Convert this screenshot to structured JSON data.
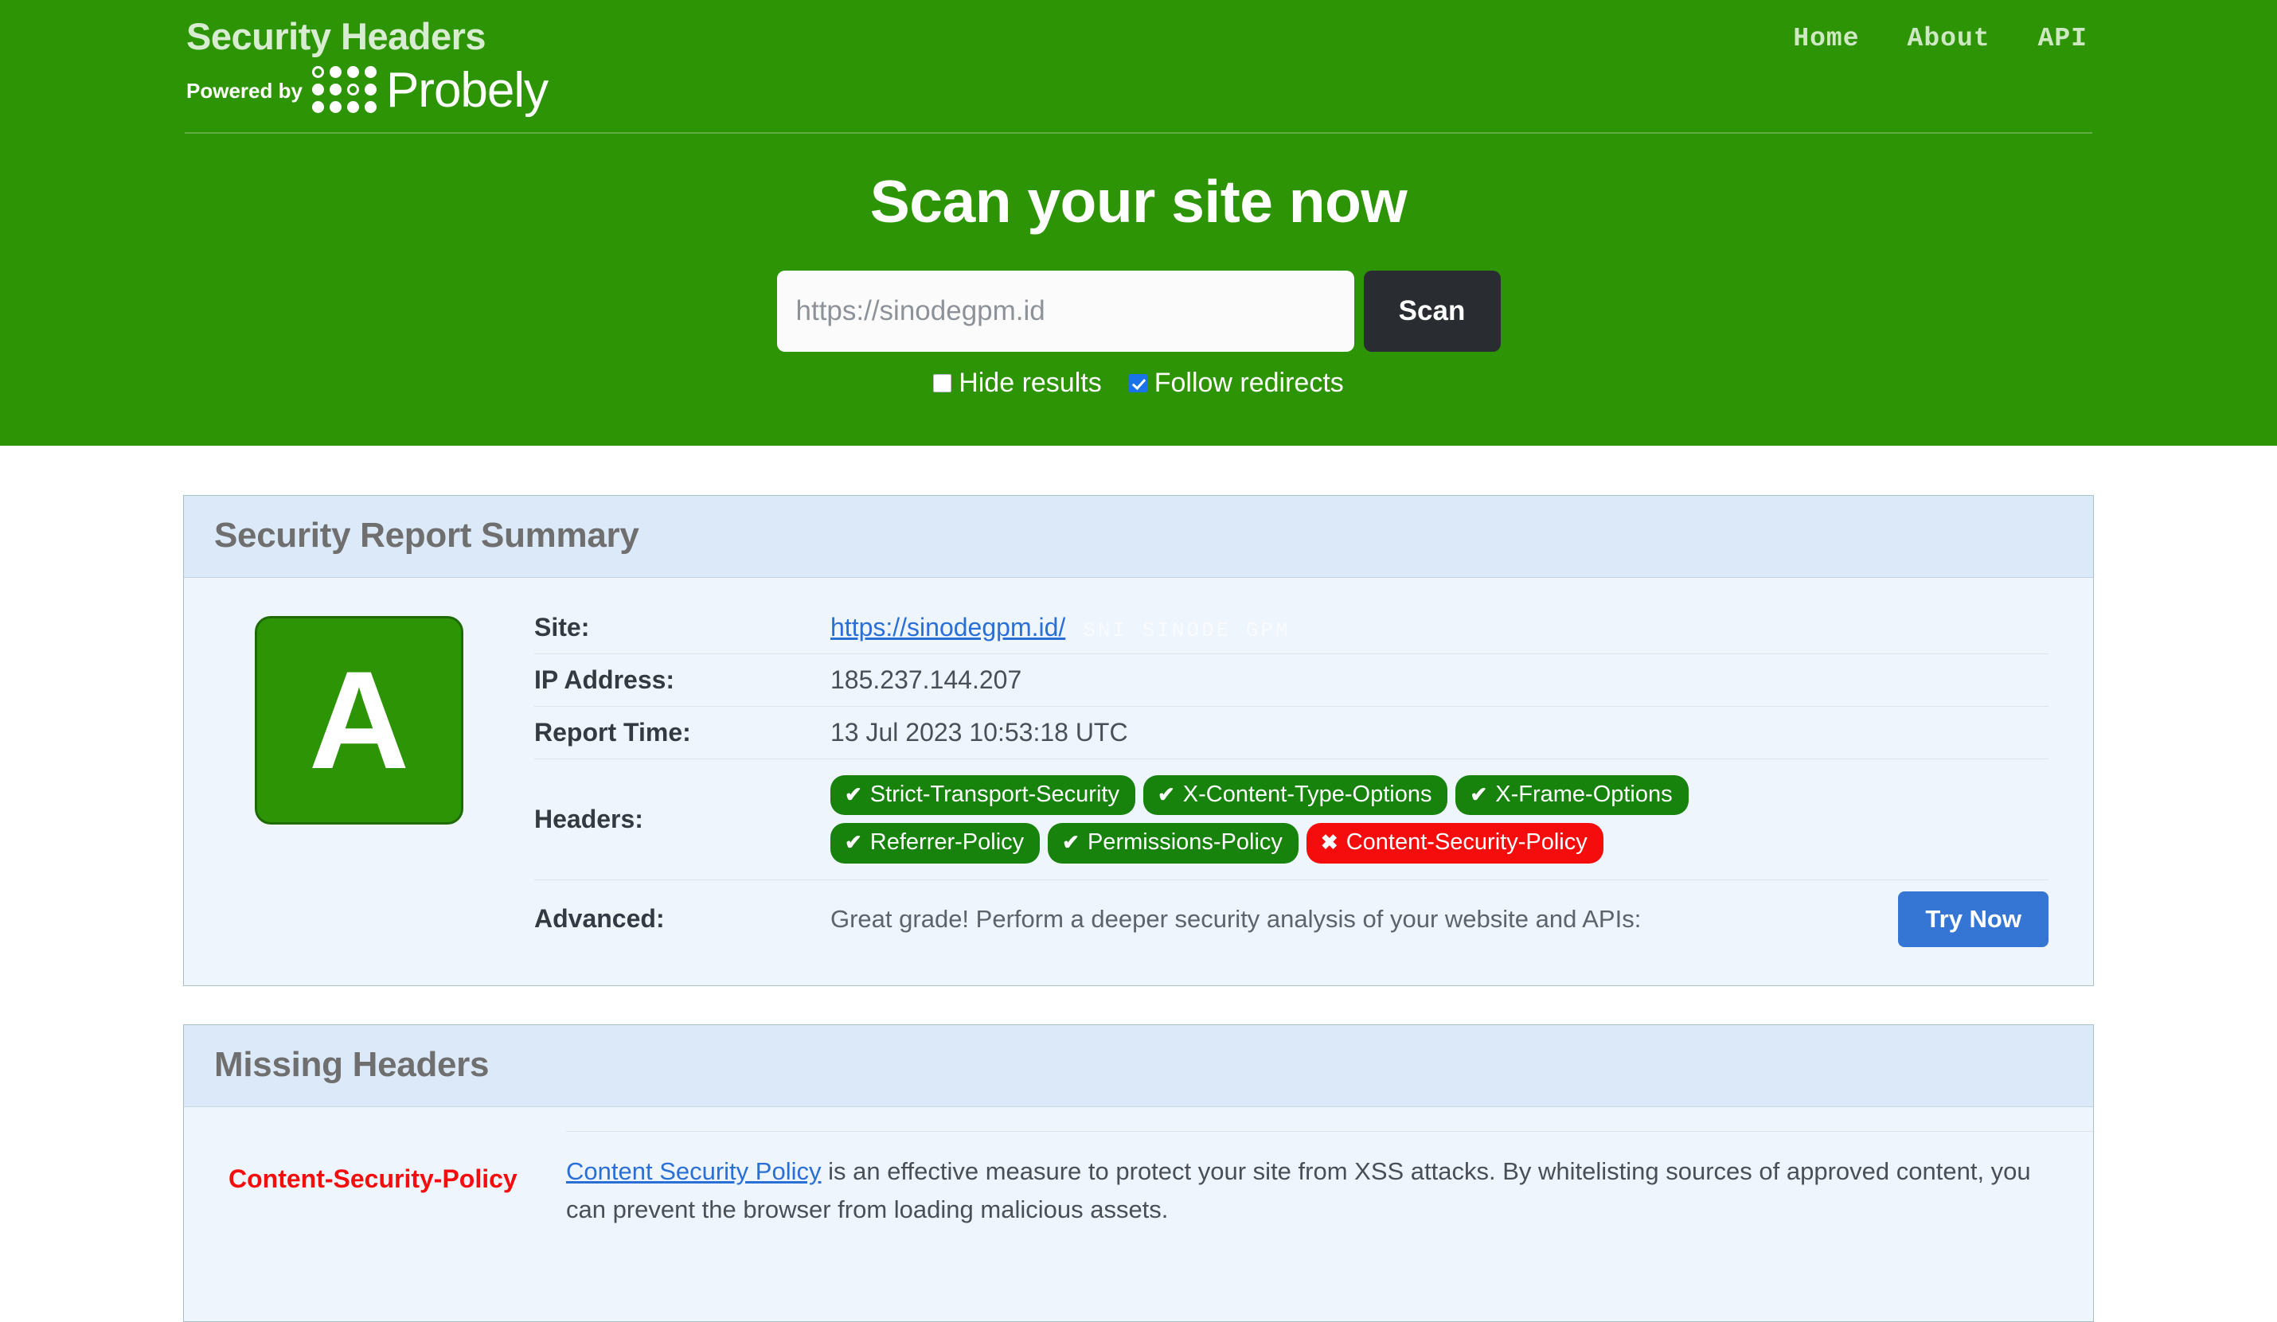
{
  "header": {
    "brand_title": "Security Headers",
    "powered_by": "Powered by",
    "brand_logo_word": "Probely",
    "nav": [
      {
        "label": "Home",
        "name": "nav-home"
      },
      {
        "label": "About",
        "name": "nav-about"
      },
      {
        "label": "API",
        "name": "nav-api"
      }
    ],
    "headline": "Scan your site now",
    "scan_form": {
      "url_placeholder": "https://sinodegpm.id",
      "url_value": "",
      "scan_button": "Scan",
      "hide_results_label": "Hide results",
      "hide_results_checked": false,
      "follow_redirects_label": "Follow redirects",
      "follow_redirects_checked": true
    },
    "background_color": "#2d9405"
  },
  "summary_panel": {
    "title": "Security Report Summary",
    "grade": "A",
    "grade_color": "#2d9405",
    "rows": {
      "site_label": "Site:",
      "site_value": "https://sinodegpm.id/",
      "site_watermark": "SNI SINODE GPM",
      "ip_label": "IP Address:",
      "ip_value": "185.237.144.207",
      "report_time_label": "Report Time:",
      "report_time_value": "13 Jul 2023 10:53:18 UTC",
      "headers_label": "Headers:",
      "advanced_label": "Advanced:",
      "advanced_text": "Great grade! Perform a deeper security analysis of your website and APIs:",
      "advanced_button": "Try Now"
    },
    "header_badges": [
      {
        "label": "Strict-Transport-Security",
        "status": "present",
        "glyph": "✔"
      },
      {
        "label": "X-Content-Type-Options",
        "status": "present",
        "glyph": "✔"
      },
      {
        "label": "X-Frame-Options",
        "status": "present",
        "glyph": "✔"
      },
      {
        "label": "Referrer-Policy",
        "status": "present",
        "glyph": "✔"
      },
      {
        "label": "Permissions-Policy",
        "status": "present",
        "glyph": "✔"
      },
      {
        "label": "Content-Security-Policy",
        "status": "missing",
        "glyph": "✖"
      }
    ],
    "badge_colors": {
      "present": "#17820c",
      "missing": "#f50d0d"
    }
  },
  "missing_panel": {
    "title": "Missing Headers",
    "items": [
      {
        "name": "Content-Security-Policy",
        "link_text": "Content Security Policy",
        "description": " is an effective measure to protect your site from XSS attacks. By whitelisting sources of approved content, you can prevent the browser from loading malicious assets."
      }
    ]
  }
}
